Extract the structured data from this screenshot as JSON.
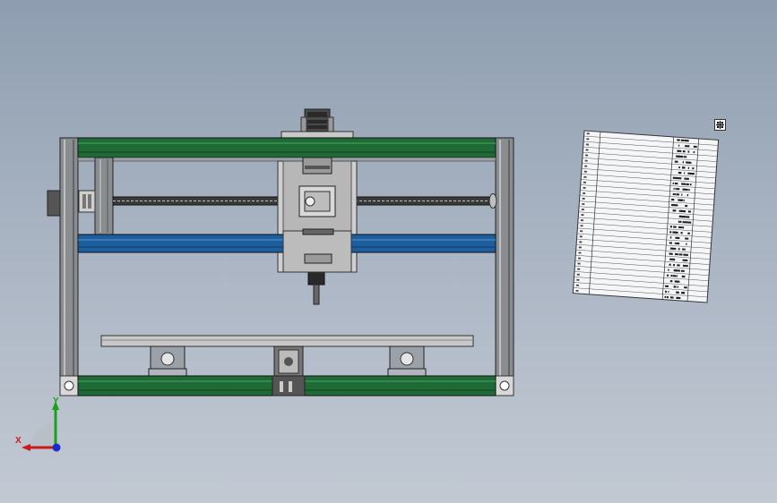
{
  "viewport": {
    "background_top": "#8e9eb0",
    "background_bottom": "#c2c9d3"
  },
  "machine": {
    "frame_color": "#8a8d90",
    "rail_color": "#1e6b35",
    "gantry_beam_color": "#1d5f9e",
    "bed_color": "#c8c8c8"
  },
  "bom_table": {
    "rows": 30,
    "move_handle_icon": "move-handle-icon"
  },
  "triad": {
    "x_label": "X",
    "y_label": "Y",
    "x_color": "#d01818",
    "y_color": "#1aa01a",
    "z_color": "#1a2ad0"
  }
}
